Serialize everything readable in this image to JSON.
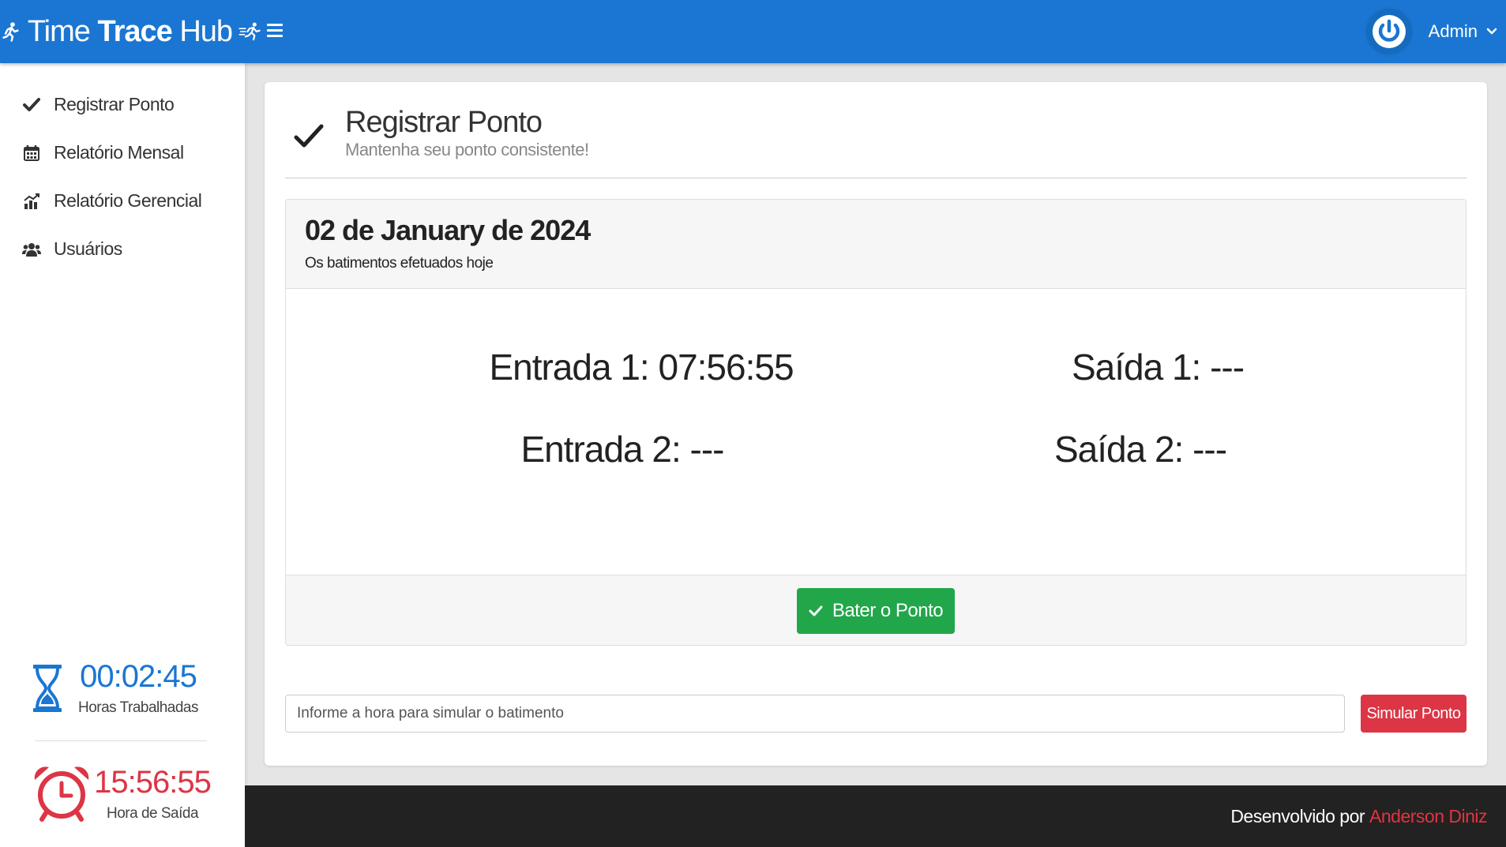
{
  "app": {
    "brand_light_1": "Time",
    "brand_bold": "Trace",
    "brand_light_2": "Hub"
  },
  "header": {
    "user_name": "Admin"
  },
  "sidebar": {
    "items": [
      {
        "label": "Registrar Ponto",
        "icon": "check-icon"
      },
      {
        "label": "Relatório Mensal",
        "icon": "calendar-icon"
      },
      {
        "label": "Relatório Gerencial",
        "icon": "chart-icon"
      },
      {
        "label": "Usuários",
        "icon": "users-icon"
      }
    ],
    "hours_worked": {
      "value": "00:02:45",
      "label": "Horas Trabalhadas",
      "color": "#1a76d2"
    },
    "exit_time": {
      "value": "15:56:55",
      "label": "Hora de Saída",
      "color": "#dc3545"
    }
  },
  "page": {
    "title": "Registrar Ponto",
    "subtitle": "Mantenha seu ponto consistente!"
  },
  "day": {
    "date": "02 de January de 2024",
    "subtitle": "Os batimentos efetuados hoje",
    "entries": {
      "entrada_1": "Entrada 1: 07:56:55",
      "saida_1": "Saída 1: ---",
      "entrada_2": "Entrada 2: ---",
      "saida_2": "Saída 2: ---"
    },
    "punch_button": "Bater o Ponto"
  },
  "simulate": {
    "placeholder": "Informe a hora para simular o batimento",
    "button": "Simular Ponto"
  },
  "footer": {
    "text": "Desenvolvido por",
    "author": "Anderson Diniz"
  },
  "colors": {
    "primary": "#1a76d2",
    "success": "#22a64a",
    "danger": "#dc3545"
  }
}
